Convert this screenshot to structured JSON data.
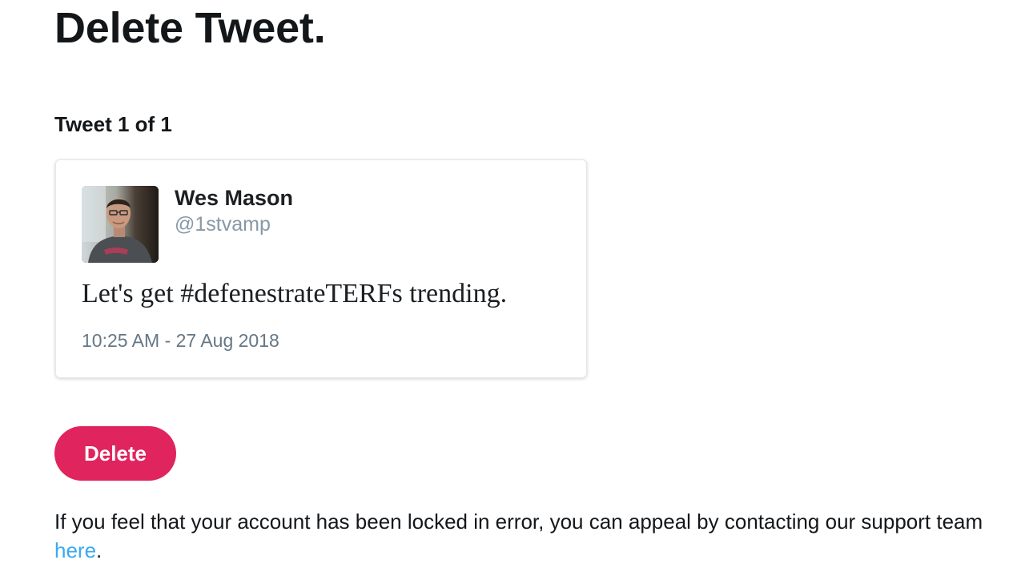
{
  "page": {
    "title": "Delete Tweet."
  },
  "counter": {
    "text": "Tweet 1 of 1"
  },
  "tweet": {
    "author_name": "Wes Mason",
    "author_handle": "@1stvamp",
    "avatar_icon": "user-photo",
    "text": "Let's get #defenestrateTERFs trending.",
    "timestamp": "10:25 AM - 27 Aug 2018"
  },
  "actions": {
    "delete_label": "Delete",
    "delete_color": "#e0245e"
  },
  "appeal": {
    "text_before": "If you feel that your account has been locked in error, you can appeal by contacting our support team ",
    "link_text": "here",
    "text_after": ".",
    "link_color": "#3ba9ee"
  }
}
